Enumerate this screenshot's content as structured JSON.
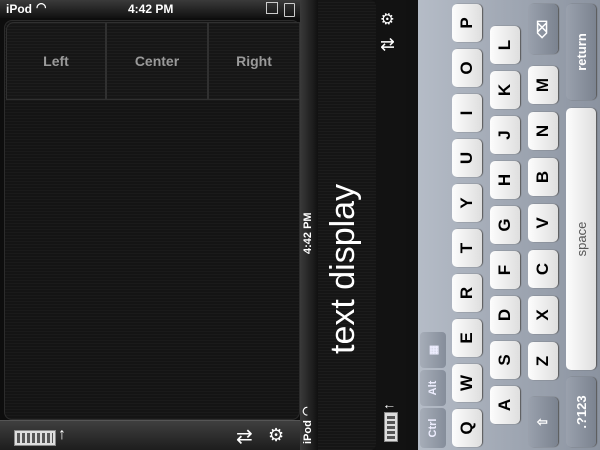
{
  "left": {
    "status": {
      "carrier": "iPod",
      "time": "4:42 PM"
    },
    "buttons": {
      "left": "Left",
      "center": "Center",
      "right": "Right"
    }
  },
  "right": {
    "status": {
      "carrier": "iPod",
      "time": "4:42 PM"
    },
    "display_text": "text display",
    "modifiers": {
      "ctrl": "Ctrl",
      "alt": "Alt"
    },
    "keyboard": {
      "row1": [
        "Q",
        "W",
        "E",
        "R",
        "T",
        "Y",
        "U",
        "I",
        "O",
        "P"
      ],
      "row2": [
        "A",
        "S",
        "D",
        "F",
        "G",
        "H",
        "J",
        "K",
        "L"
      ],
      "row3": [
        "Z",
        "X",
        "C",
        "V",
        "B",
        "N",
        "M"
      ],
      "numbers_key": ".?123",
      "space_key": "space",
      "return_key": "return"
    }
  },
  "icons": {
    "wifi": "wifi-icon",
    "battery": "battery-icon",
    "keyboard": "keyboard-icon",
    "up_arrow": "up-arrow-icon",
    "swap": "swap-icon",
    "settings": "gear-icon",
    "shift": "shift-icon",
    "backspace": "backspace-icon",
    "windows": "windows-icon"
  }
}
